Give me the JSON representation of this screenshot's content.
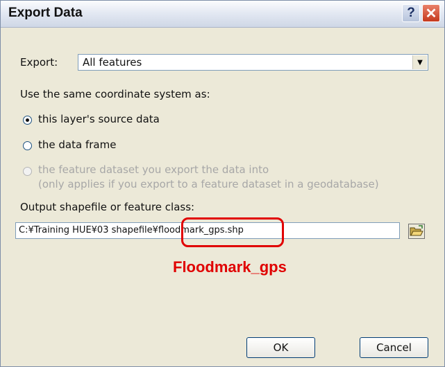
{
  "window": {
    "title": "Export Data",
    "help_glyph": "?",
    "close_glyph": "✕"
  },
  "export": {
    "label": "Export:",
    "selected": "All features"
  },
  "coordinate_system": {
    "heading": "Use the same coordinate system as:",
    "options": [
      {
        "label": "this layer's source data",
        "checked": true,
        "enabled": true
      },
      {
        "label": "the data frame",
        "checked": false,
        "enabled": true
      },
      {
        "label": "the feature dataset you export the data into",
        "note": "(only applies if you export to a feature dataset in a geodatabase)",
        "checked": false,
        "enabled": false
      }
    ]
  },
  "output": {
    "label": "Output shapefile or feature class:",
    "value": "C:¥Training HUE¥03 shapefile¥floodmark_gps.shp",
    "browse_icon": "open-folder-icon"
  },
  "annotation": {
    "text": "Floodmark_gps",
    "color": "#e00000"
  },
  "buttons": {
    "ok": "OK",
    "cancel": "Cancel"
  }
}
